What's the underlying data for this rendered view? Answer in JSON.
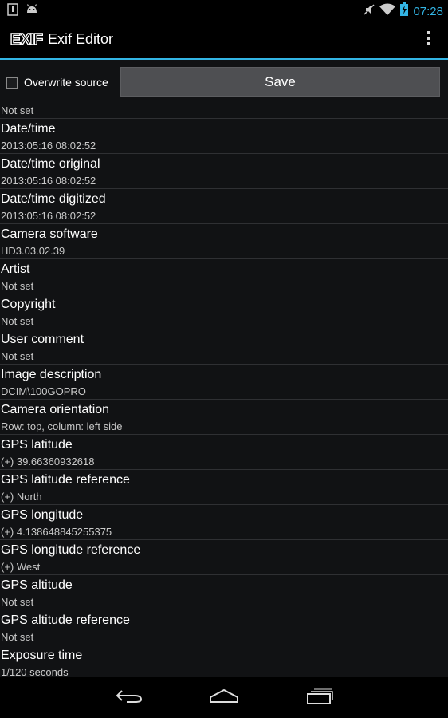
{
  "status": {
    "time": "07:28",
    "icons": [
      "notification-icon",
      "android-icon",
      "mute-icon",
      "wifi-icon",
      "battery-charging-icon"
    ]
  },
  "actionbar": {
    "logo_text": "EXIF",
    "title": "Exif Editor",
    "overflow_icon": "overflow-menu-icon"
  },
  "controls": {
    "overwrite_label": "Overwrite source",
    "overwrite_checked": false,
    "save_label": "Save"
  },
  "list": {
    "partial_top_value": "Not set",
    "items": [
      {
        "title": "Date/time",
        "value": "2013:05:16 08:02:52"
      },
      {
        "title": "Date/time original",
        "value": "2013:05:16 08:02:52"
      },
      {
        "title": "Date/time digitized",
        "value": "2013:05:16 08:02:52"
      },
      {
        "title": "Camera software",
        "value": "HD3.03.02.39"
      },
      {
        "title": "Artist",
        "value": "Not set"
      },
      {
        "title": "Copyright",
        "value": "Not set"
      },
      {
        "title": "User comment",
        "value": "Not set"
      },
      {
        "title": "Image description",
        "value": "DCIM\\100GOPRO"
      },
      {
        "title": "Camera orientation",
        "value": "Row: top, column: left side"
      },
      {
        "title": "GPS latitude",
        "value": "(+) 39.66360932618"
      },
      {
        "title": "GPS latitude reference",
        "value": "(+) North"
      },
      {
        "title": "GPS longitude",
        "value": "(+) 4.138648845255375"
      },
      {
        "title": "GPS longitude reference",
        "value": "(+) West"
      },
      {
        "title": "GPS altitude",
        "value": "Not set"
      },
      {
        "title": "GPS altitude reference",
        "value": "Not set"
      },
      {
        "title": "Exposure time",
        "value": "1/120 seconds"
      }
    ]
  },
  "navbar": {
    "back_icon": "back-icon",
    "home_icon": "home-icon",
    "recents_icon": "recents-icon"
  }
}
